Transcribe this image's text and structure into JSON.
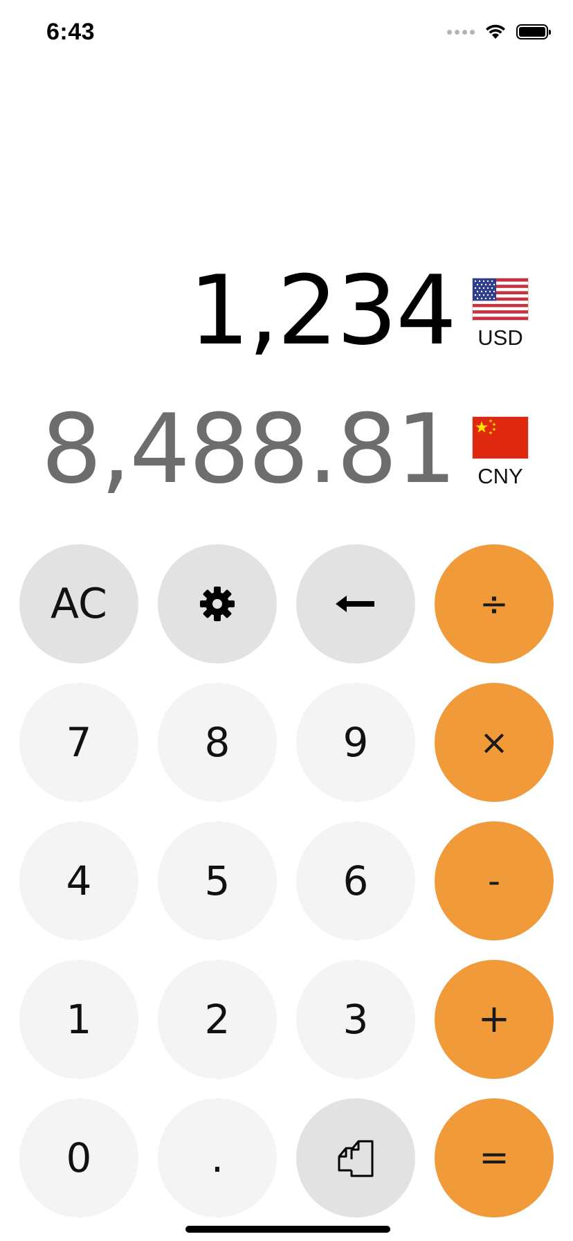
{
  "status_bar": {
    "time": "6:43",
    "icons": [
      "signal-icon",
      "wifi-icon",
      "battery-icon"
    ]
  },
  "display": {
    "source": {
      "amount": "1,234",
      "currency": "USD",
      "flag": "us-flag-icon"
    },
    "target": {
      "amount": "8,488.81",
      "currency": "CNY",
      "flag": "cn-flag-icon"
    }
  },
  "keypad": {
    "clear": "AC",
    "settings_icon": "gear-icon",
    "backspace_icon": "backspace-arrow-icon",
    "divide": "÷",
    "seven": "7",
    "eight": "8",
    "nine": "9",
    "multiply": "×",
    "four": "4",
    "five": "5",
    "six": "6",
    "subtract": "-",
    "one": "1",
    "two": "2",
    "three": "3",
    "add": "+",
    "zero": "0",
    "decimal": ".",
    "swap_icon": "swap-copy-icon",
    "equals": "="
  },
  "colors": {
    "operator": "#f09a3a",
    "function_key": "#e2e2e2",
    "digit_key": "#f4f4f4",
    "primary_text": "#000000",
    "secondary_text": "#6d6d6d"
  }
}
